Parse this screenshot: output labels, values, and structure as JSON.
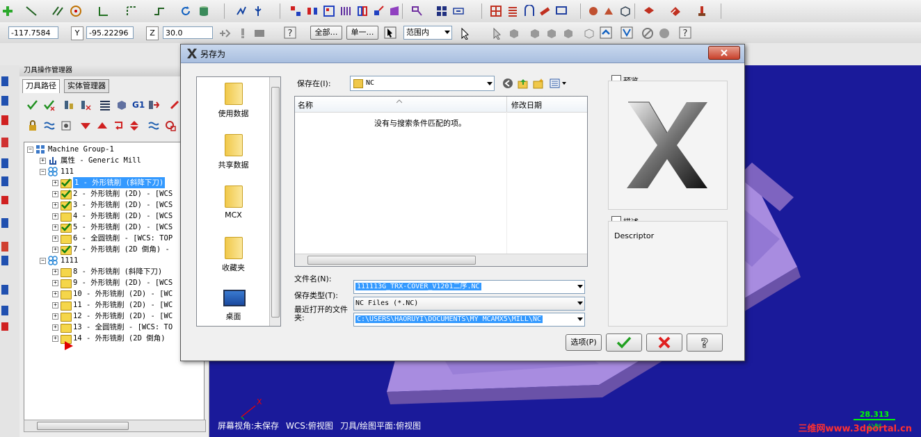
{
  "coords": {
    "x_value": "-117.7584",
    "y_label": "Y",
    "y_value": "-95.22296",
    "z_label": "Z",
    "z_value": "30.0"
  },
  "toolbar2": {
    "all_button": "全部…",
    "single_button": "单一…",
    "range_select": "范围内"
  },
  "manager": {
    "title": "刀具操作管理器",
    "tab_toolpath": "刀具路径",
    "tab_solids": "实体管理器",
    "g1": "G1"
  },
  "tree": [
    {
      "text": "Machine Group-1",
      "indent": 0,
      "icon": "group"
    },
    {
      "text": "属性 - Generic Mill",
      "indent": 1,
      "icon": "props"
    },
    {
      "text": "111",
      "indent": 1,
      "icon": "ops"
    },
    {
      "text": "1 - 外形铣削 (斜降下刀)",
      "indent": 2,
      "icon": "check",
      "selected": true
    },
    {
      "text": "2 - 外形铣削 (2D) - [WCS",
      "indent": 2,
      "icon": "check"
    },
    {
      "text": "3 - 外形铣削 (2D) - [WCS",
      "indent": 2,
      "icon": "check"
    },
    {
      "text": "4 - 外形铣削 (2D) - [WCS",
      "indent": 2,
      "icon": "folder"
    },
    {
      "text": "5 - 外形铣削 (2D) - [WCS",
      "indent": 2,
      "icon": "check"
    },
    {
      "text": "6 - 全圆铣削 - [WCS: TOP",
      "indent": 2,
      "icon": "folder"
    },
    {
      "text": "7 - 外形铣削 (2D 倒角) -",
      "indent": 2,
      "icon": "check"
    },
    {
      "text": "1111",
      "indent": 1,
      "icon": "ops"
    },
    {
      "text": "8 - 外形铣削 (斜降下刀)",
      "indent": 2,
      "icon": "folder"
    },
    {
      "text": "9 - 外形铣削 (2D) - [WCS",
      "indent": 2,
      "icon": "folder"
    },
    {
      "text": "10 - 外形铣削 (2D) - [WC",
      "indent": 2,
      "icon": "folder"
    },
    {
      "text": "11 - 外形铣削 (2D) - [WC",
      "indent": 2,
      "icon": "folder"
    },
    {
      "text": "12 - 外形铣削 (2D) - [WC",
      "indent": 2,
      "icon": "folder"
    },
    {
      "text": "13 - 全圆铣削 - [WCS: TO",
      "indent": 2,
      "icon": "folder"
    },
    {
      "text": "14 - 外形铣削 (2D 倒角)",
      "indent": 2,
      "icon": "folder"
    }
  ],
  "dialog": {
    "title": "另存为",
    "save_in_label": "保存在(I):",
    "save_in_value": "NC",
    "col_name": "名称",
    "col_date": "修改日期",
    "empty_msg": "没有与搜索条件匹配的项。",
    "places": [
      "使用数据",
      "共享数据",
      "MCX",
      "收藏夹",
      "桌面"
    ],
    "filename_label": "文件名(N):",
    "filename_value": "111113G_TRX-COVER_V1201二序.NC",
    "filetype_label": "保存类型(T):",
    "filetype_value": "NC Files (*.NC)",
    "recent_label": "最近打开的文件夹:",
    "recent_value": "C:\\USERS\\HAORUYI\\DOCUMENTS\\MY MCAMX5\\MILL\\NC",
    "preview_label": "预览",
    "describe_label": "描述",
    "descriptor": "Descriptor",
    "options_button": "选项(P)"
  },
  "status": {
    "screen_view": "屏幕视角:未保存",
    "wcs": "WCS:俯视图",
    "plane": "刀具/绘图平面:俯视图",
    "axis_x": "X",
    "scale_value": "28.313",
    "scale_unit": "公制",
    "watermark": "三维网www.3dportal.cn"
  },
  "colors": {
    "viewport": "#1a1a9a",
    "part": "#b79ae8",
    "selection": "#3399ff"
  }
}
